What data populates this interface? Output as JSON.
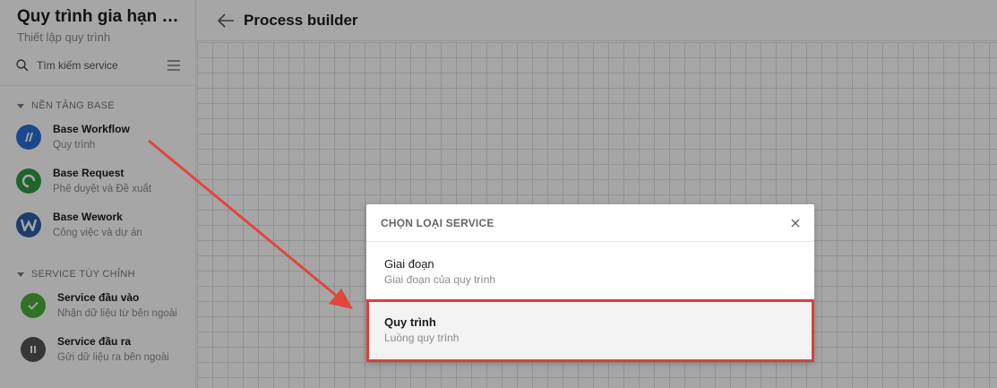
{
  "sidebar": {
    "app_title": "Quy trình gia hạn hợ...",
    "app_subtitle": "Thiết lập quy trình",
    "search_placeholder": "Tìm kiếm service",
    "section_base": "NỀN TẢNG BASE",
    "section_custom": "SERVICE TÙY CHỈNH",
    "base_items": [
      {
        "name": "Base Workflow",
        "desc": "Quy trình",
        "color": "#2b6fd6"
      },
      {
        "name": "Base Request",
        "desc": "Phê duyệt và Đề xuất",
        "color": "#2e9b44"
      },
      {
        "name": "Base Wework",
        "desc": "Công việc và dự án",
        "color": "#2f5fa8"
      }
    ],
    "custom_items": [
      {
        "name": "Service đầu vào",
        "desc": "Nhận dữ liệu từ bên ngoài",
        "color": "#4caf3c"
      },
      {
        "name": "Service đầu ra",
        "desc": "Gửi dữ liệu ra bên ngoài",
        "color": "#555555"
      }
    ]
  },
  "header": {
    "title": "Process builder"
  },
  "modal": {
    "title": "CHỌN LOẠI SERVICE",
    "options": [
      {
        "name": "Giai đoạn",
        "desc": "Giai đoạn của quy trình"
      },
      {
        "name": "Quy trình",
        "desc": "Luồng quy trình"
      }
    ]
  },
  "colors": {
    "annotation": "#d9403a"
  }
}
